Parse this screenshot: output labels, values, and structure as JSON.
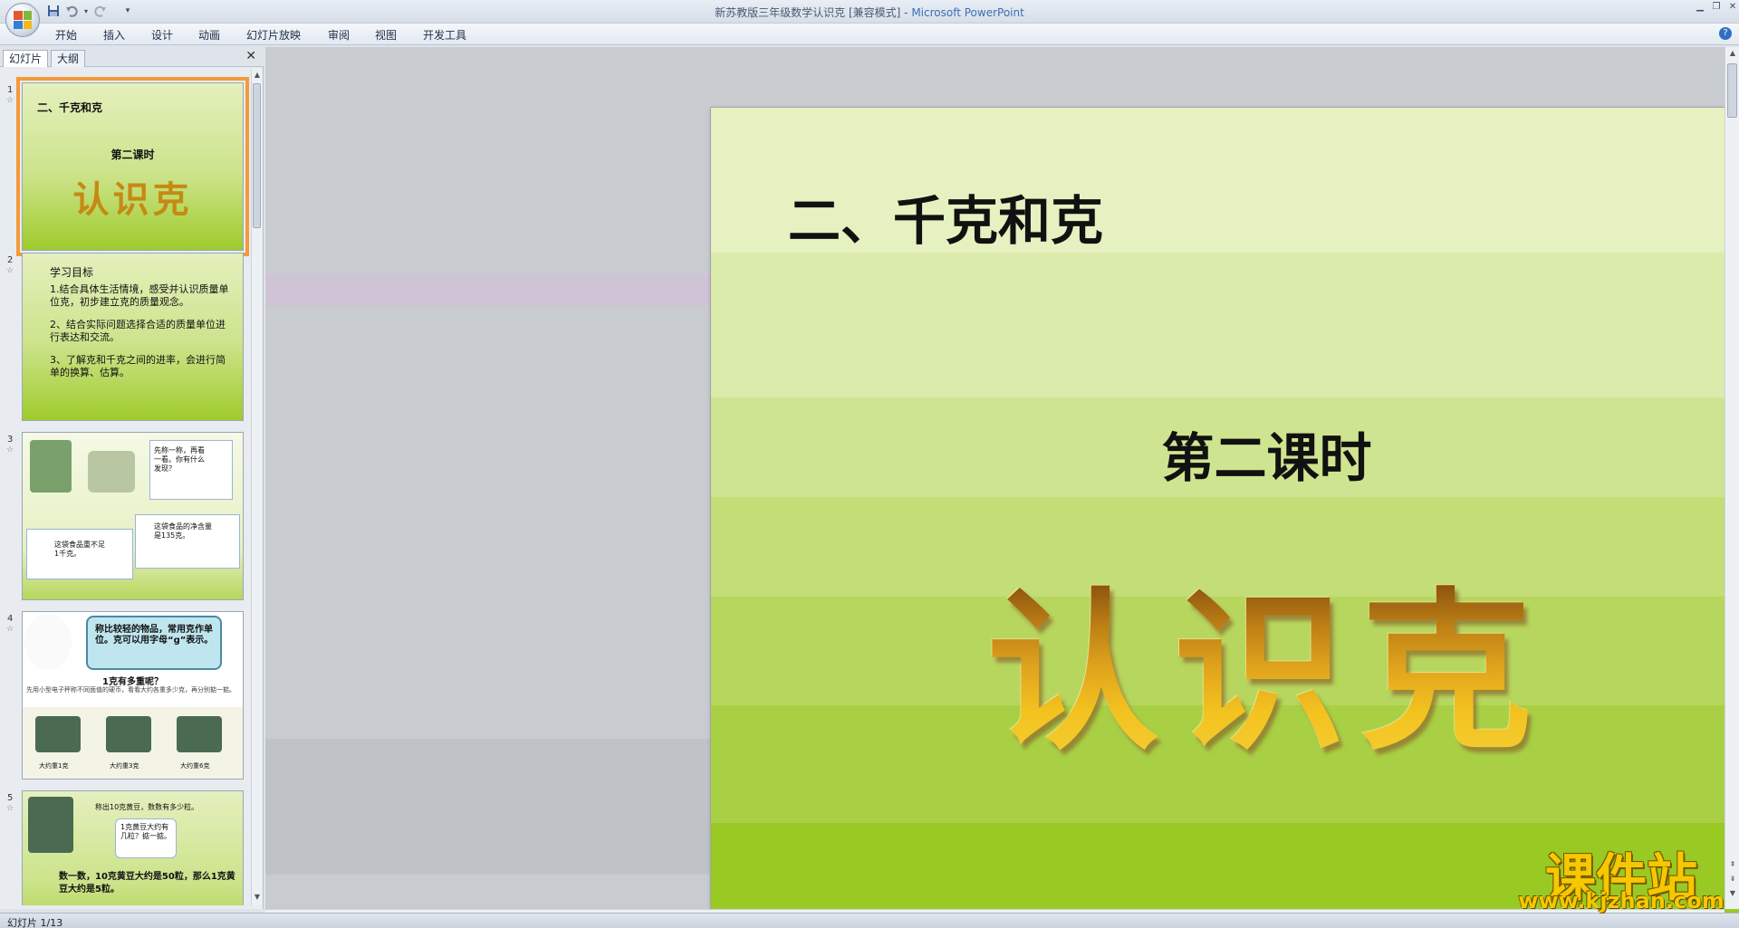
{
  "window": {
    "doc_name": "新苏教版三年级数学认识克 [兼容模式]",
    "separator": " - ",
    "app_name": "Microsoft PowerPoint",
    "min_icon": "minimize-icon",
    "max_icon": "restore-icon",
    "close_icon": "close-icon"
  },
  "quick_access": {
    "save_icon": "save-icon",
    "undo_icon": "undo-icon",
    "redo_icon": "redo-icon",
    "customize_icon": "dropdown-icon"
  },
  "ribbon": {
    "tabs": [
      "开始",
      "插入",
      "设计",
      "动画",
      "幻灯片放映",
      "审阅",
      "视图",
      "开发工具"
    ],
    "help_label": "?"
  },
  "left_pane": {
    "tab_slides": "幻灯片",
    "tab_outline": "大纲",
    "close_label": "✕",
    "thumbnails": [
      {
        "num": "1",
        "title": "二、千克和克",
        "subtitle": "第二课时",
        "wordart": "认识克"
      },
      {
        "num": "2",
        "heading": "学习目标",
        "items": [
          "1.结合具体生活情境，感受并认识质量单位克，初步建立克的质量观念。",
          "2、结合实际问题选择合适的质量单位进行表达和交流。",
          "3、了解克和千克之间的进率，会进行简单的换算、估算。"
        ]
      },
      {
        "num": "3",
        "bubble1": "先称一称，再看一看。你有什么发现？",
        "bubble2": "这袋食品重不足1千克。",
        "bubble3": "这袋食品的净含量是135克。"
      },
      {
        "num": "4",
        "bubble": "称比较轻的物品，常用克作单位。克可以用字母“g”表示。",
        "question": "1克有多重呢？",
        "note": "先用小型电子秤称不同面值的硬币，看看大约各重多少克，再分别掂一掂。",
        "captions": [
          "大约重1克",
          "大约重3克",
          "大约重6克"
        ]
      },
      {
        "num": "5",
        "note": "称出10克黄豆，数数有多少粒。",
        "bubble": "1克黄豆大约有几粒？掂一掂。",
        "caption": "数一数，10克黄豆大约是50粒，那么1克黄豆大约是5粒。"
      }
    ]
  },
  "slide": {
    "title": "二、千克和克",
    "subtitle": "第二课时",
    "wordart": "认识克"
  },
  "status": {
    "text": "幻灯片 1/13"
  },
  "watermark": {
    "title": "课件站",
    "url": "www.kjzhan.com"
  },
  "colors": {
    "selection": "#f39a3a",
    "app_name": "#3c6fb4",
    "slide_top": "#e5f1c0",
    "slide_bottom": "#97c91f"
  }
}
